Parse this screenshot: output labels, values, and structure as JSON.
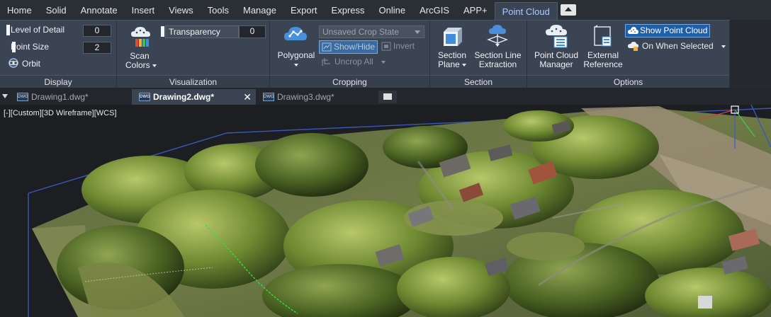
{
  "ribbon_tabs": [
    "Home",
    "Solid",
    "Annotate",
    "Insert",
    "Views",
    "Tools",
    "Manage",
    "Export",
    "Express",
    "Online",
    "ArcGIS",
    "APP+",
    "Point Cloud"
  ],
  "active_tab": "Point Cloud",
  "panels": {
    "display": {
      "title": "Display",
      "level_of_detail_label": "Level of Detail",
      "level_of_detail_value": "0",
      "point_size_label": "Point Size",
      "point_size_value": "2",
      "orbit_label": "Orbit"
    },
    "visualization": {
      "title": "Visualization",
      "scan_colors_line1": "Scan",
      "scan_colors_line2": "Colors",
      "transparency_label": "Transparency",
      "transparency_value": "0"
    },
    "cropping": {
      "title": "Cropping",
      "polygonal_label": "Polygonal",
      "crop_state": "Unsaved Crop State",
      "show_hide_label": "Show/Hide",
      "invert_label": "Invert",
      "uncrop_all_label": "Uncrop All"
    },
    "section": {
      "title": "Section",
      "section_plane_line1": "Section",
      "section_plane_line2": "Plane",
      "section_line_line1": "Section Line",
      "section_line_line2": "Extraction"
    },
    "options": {
      "title": "Options",
      "manager_line1": "Point Cloud",
      "manager_line2": "Manager",
      "external_ref_line1": "External",
      "external_ref_line2": "Reference",
      "show_point_cloud_label": "Show Point Cloud",
      "on_when_selected_label": "On When Selected"
    }
  },
  "file_tabs": [
    {
      "name": "Drawing1.dwg*",
      "active": false
    },
    {
      "name": "Drawing2.dwg*",
      "active": true
    },
    {
      "name": "Drawing3.dwg*",
      "active": false
    }
  ],
  "viewport_label": "[-][Custom][3D Wireframe][WCS]",
  "colors": {
    "ribbon_bg": "#3b4452",
    "tab_strip_bg": "#2a2f36",
    "active_tab_text": "#a9cbff",
    "highlight_blue": "#1f5fa8",
    "canvas_bg": "#1c1e22"
  }
}
